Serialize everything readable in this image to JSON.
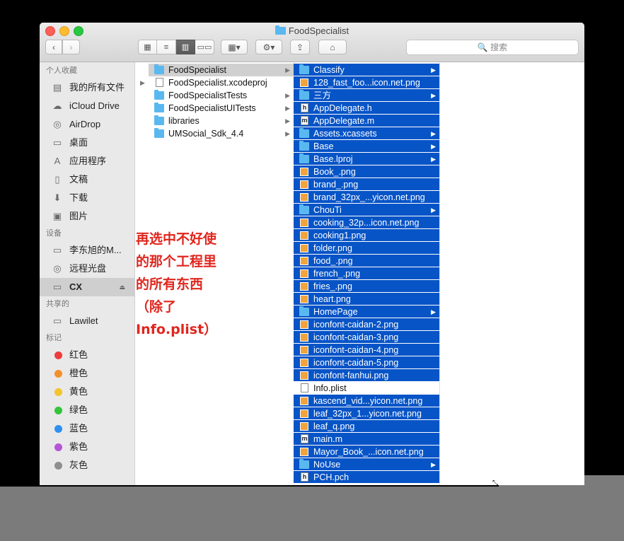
{
  "window": {
    "title": "FoodSpecialist"
  },
  "toolbar": {
    "back": "‹",
    "forward": "›",
    "views": [
      "▦",
      "≡",
      "▥",
      "▭▭"
    ],
    "arrange": "▦▾",
    "action": "⚙▾",
    "share": "⇪",
    "tag": "⌂",
    "search_placeholder": "🔍 搜索"
  },
  "sidebar": {
    "favorites_title": "个人收藏",
    "favorites": [
      {
        "label": "我的所有文件",
        "icon": "▤"
      },
      {
        "label": "iCloud Drive",
        "icon": "☁"
      },
      {
        "label": "AirDrop",
        "icon": "◎"
      },
      {
        "label": "桌面",
        "icon": "▭"
      },
      {
        "label": "应用程序",
        "icon": "A"
      },
      {
        "label": "文稿",
        "icon": "▯"
      },
      {
        "label": "下载",
        "icon": "⬇"
      },
      {
        "label": "图片",
        "icon": "▣"
      }
    ],
    "devices_title": "设备",
    "devices": [
      {
        "label": "李东旭的M...",
        "icon": "▭"
      },
      {
        "label": "远程光盘",
        "icon": "◎"
      },
      {
        "label": "CX",
        "icon": "▭",
        "eject": "⏏"
      }
    ],
    "shared_title": "共享的",
    "shared": [
      {
        "label": "Lawilet",
        "icon": "▭"
      }
    ],
    "tags_title": "标记",
    "tags": [
      {
        "label": "红色",
        "color": "#ee3b3b"
      },
      {
        "label": "橙色",
        "color": "#f3902c"
      },
      {
        "label": "黄色",
        "color": "#f5c32c"
      },
      {
        "label": "绿色",
        "color": "#35c43a"
      },
      {
        "label": "蓝色",
        "color": "#2f8ff0"
      },
      {
        "label": "紫色",
        "color": "#b555d8"
      },
      {
        "label": "灰色",
        "color": "#8e8e8e"
      }
    ]
  },
  "column1": [
    {
      "label": "FoodSpecialist",
      "kind": "folder",
      "chevron": "▶",
      "selected": true
    },
    {
      "label": "FoodSpecialist.xcodeproj",
      "kind": "file",
      "disclose": "▶"
    },
    {
      "label": "FoodSpecialistTests",
      "kind": "folder",
      "chevron": "▶"
    },
    {
      "label": "FoodSpecialistUITests",
      "kind": "folder",
      "chevron": "▶"
    },
    {
      "label": "libraries",
      "kind": "folder",
      "chevron": "▶"
    },
    {
      "label": "UMSocial_Sdk_4.4",
      "kind": "folder",
      "chevron": "▶"
    }
  ],
  "column2": [
    {
      "label": "Classify",
      "kind": "folder",
      "chevron": "▶"
    },
    {
      "label": "128_fast_foo...icon.net.png",
      "kind": "img"
    },
    {
      "label": "三方",
      "kind": "folder",
      "chevron": "▶"
    },
    {
      "label": "AppDelegate.h",
      "kind": "file",
      "letter": "h"
    },
    {
      "label": "AppDelegate.m",
      "kind": "file",
      "letter": "m"
    },
    {
      "label": "Assets.xcassets",
      "kind": "folder",
      "chevron": "▶"
    },
    {
      "label": "Base",
      "kind": "folder",
      "chevron": "▶"
    },
    {
      "label": "Base.lproj",
      "kind": "folder",
      "chevron": "▶"
    },
    {
      "label": "Book_.png",
      "kind": "img"
    },
    {
      "label": "brand_.png",
      "kind": "img"
    },
    {
      "label": "brand_32px_...yicon.net.png",
      "kind": "img"
    },
    {
      "label": "ChouTi",
      "kind": "folder",
      "chevron": "▶"
    },
    {
      "label": "cooking_32p...icon.net.png",
      "kind": "img"
    },
    {
      "label": "cooking1.png",
      "kind": "img"
    },
    {
      "label": "folder.png",
      "kind": "img"
    },
    {
      "label": "food_.png",
      "kind": "img"
    },
    {
      "label": "french_.png",
      "kind": "img"
    },
    {
      "label": "fries_.png",
      "kind": "img"
    },
    {
      "label": "heart.png",
      "kind": "img"
    },
    {
      "label": "HomePage",
      "kind": "folder",
      "chevron": "▶"
    },
    {
      "label": "iconfont-caidan-2.png",
      "kind": "img"
    },
    {
      "label": "iconfont-caidan-3.png",
      "kind": "img"
    },
    {
      "label": "iconfont-caidan-4.png",
      "kind": "img"
    },
    {
      "label": "iconfont-caidan-5.png",
      "kind": "img"
    },
    {
      "label": "iconfont-fanhui.png",
      "kind": "img"
    },
    {
      "label": "Info.plist",
      "kind": "file",
      "letter": "",
      "plain": true
    },
    {
      "label": "kascend_vid...yicon.net.png",
      "kind": "img"
    },
    {
      "label": "leaf_32px_1...yicon.net.png",
      "kind": "img"
    },
    {
      "label": "leaf_q.png",
      "kind": "img"
    },
    {
      "label": "main.m",
      "kind": "file",
      "letter": "m"
    },
    {
      "label": "Mayor_Book_...icon.net.png",
      "kind": "img"
    },
    {
      "label": "NoUse",
      "kind": "folder",
      "chevron": "▶"
    },
    {
      "label": "PCH.pch",
      "kind": "file",
      "letter": "h"
    }
  ],
  "annotation": "再选中不好使\n的那个工程里\n的所有东西\n（除了\nInfo.plist）"
}
